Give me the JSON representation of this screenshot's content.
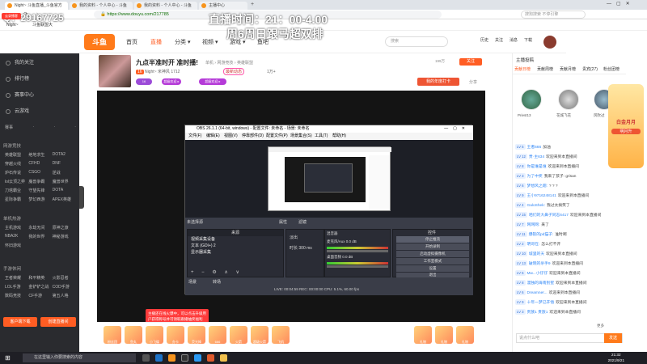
{
  "browser": {
    "tabs": [
      {
        "label": "Night~ 斗鱼直播_斗鱼官方"
      },
      {
        "label": "我的资料 - 个人中心 - 斗鱼"
      },
      {
        "label": "我的资料 - 个人中心 - 斗鱼"
      },
      {
        "label": "主播中心"
      }
    ],
    "url": "https://www.douyu.com/217785",
    "search_placeholder": "搜狗搜索 不停引擎",
    "bookmarks": [
      "Night~",
      "斗鱼联盟大"
    ]
  },
  "overlay": {
    "qq": "Q：29167725",
    "live_time": "直播时间：21：00-4.00",
    "schedule": "周6周日跟马超双排",
    "corner_badge": "云录播客"
  },
  "header": {
    "logo": "斗鱼",
    "nav": [
      "首页",
      "直播",
      "分类 ▾",
      "视频 ▾",
      "游戏 ▾",
      "鱼吧"
    ],
    "search_placeholder": "搜索",
    "user_icons": [
      "历史",
      "关注",
      "消息",
      "下载"
    ]
  },
  "sidebar": {
    "items": [
      "我的关注",
      "排行榜",
      "赛事中心",
      "云游戏"
    ],
    "icons_row": [
      "赛事",
      "·",
      "·",
      "·"
    ],
    "sections": [
      {
        "title": "网游竞技",
        "entries": [
          "英雄联盟",
          "绝地求生",
          "DOTA2",
          "穿越火线",
          "CFHD",
          "DNF",
          "炉石传说",
          "CSGO",
          "逆战",
          "lol云顶之弈",
          "魔兽争霸",
          "魔兽世界",
          "刀塔霸业",
          "守望先锋",
          "DOTA",
          "星际争霸",
          "梦幻西游",
          "APEX英雄"
        ]
      },
      {
        "title": "单机热游",
        "entries": [
          "主机游戏",
          "永劫无间",
          "原神之旅",
          "NBA2K",
          "我的世界",
          "神秘游戏",
          "怀旧游戏",
          "",
          ""
        ]
      },
      {
        "title": "手游休闲",
        "entries": [
          "王者荣耀",
          "和平精英",
          "火影忍者",
          "LOL手游",
          "金铲铲之战",
          "COD手游",
          "数码竞技",
          "CF手游",
          "第五人格"
        ]
      }
    ],
    "footer_buttons": [
      "客户端下载",
      "创建直播间"
    ]
  },
  "room": {
    "title": "九点半准时开 准时播!",
    "category": "单机",
    "tags": [
      "网游竞技",
      "英雄联盟"
    ],
    "anchor": "Night~ 米神风",
    "level": "16",
    "fans": "1712",
    "hot": "1万+",
    "badges": [
      "最新动态",
      "超级欢迎 ▸",
      "超级欢迎 ▸"
    ],
    "follow_button": "关注",
    "report_button": "举报",
    "follower_count": "199万",
    "share_label": "分享",
    "activity_badge": "我的年度打卡"
  },
  "obs": {
    "window_title": "OBS 26.1.1 (64-bit, windows) - 配置文件: 未命名 - 场景: 未命名",
    "menu": [
      "文件(F)",
      "编辑(E)",
      "视图(V)",
      "停靠部件(D)",
      "配置文件(P)",
      "场景集合(S)",
      "工具(T)",
      "帮助(H)"
    ],
    "status_text": "未选择源",
    "properties_label": "属性",
    "filters_label": "滤镜",
    "sources_header": "来源",
    "sources": [
      "视频采集设备",
      "文本 (GDI+) 2",
      "显示器采集"
    ],
    "audio_header": "混音器",
    "audio_channels": [
      {
        "name": "麦克风/Aux",
        "level": "0.0 dB"
      },
      {
        "name": "桌面音频",
        "level": "0.0 dB"
      }
    ],
    "transition": "淡出",
    "duration_label": "时长",
    "duration_value": "300 ms",
    "controls_header": "控件",
    "controls": [
      "停止推流",
      "开始录制",
      "启动虚拟摄像机",
      "工作室模式",
      "设置",
      "退出"
    ],
    "tabs": [
      "场景",
      "转场"
    ],
    "statusbar": "LIVE: 00:04:59  REC: 00:00:00  CPU: 5.1%, 60.00 fps"
  },
  "gift_tip": "主播还在线火爆中，可以点击升级用户获得称号并可领取跟播抽奖福利",
  "gifts": [
    "粉丝团",
    "鱼丸",
    "小飞碟",
    "办卡",
    "荧光棒",
    "666",
    "火箭",
    "超级火箭",
    "飞机",
    "礼物",
    "礼物",
    "礼物",
    "礼物",
    "礼物",
    "礼物"
  ],
  "chat": {
    "top_label": "主播投稿",
    "tabs": [
      "贡献日榜",
      "贡献周榜",
      "贡献月榜",
      "贵宾(27)",
      "粉丝团榜"
    ],
    "rank_names": [
      "Priest13",
      "花城飞花",
      "风吹过"
    ],
    "messages": [
      {
        "level": "LV 5",
        "nick": "王者666",
        "text": "加油"
      },
      {
        "level": "LV 12",
        "nick": "贵·主634",
        "text": "欢迎来到本直播间"
      },
      {
        "level": "LV 8",
        "nick": "你是谁是谁",
        "text": "欢迎来到本直播间"
      },
      {
        "level": "LV 3",
        "nick": "为了中奖",
        "text": "我来了孩子: grisan"
      },
      {
        "level": "LV 6",
        "nick": "梦想风之翔:",
        "text": "? ? ?"
      },
      {
        "level": "LV 9",
        "nick": "王小9716248141",
        "text": "欢迎来到本直播间"
      },
      {
        "level": "LV 4",
        "nick": "GaloShek:",
        "text": "我过太搞笑了"
      },
      {
        "level": "LV 15",
        "nick": "咱们的大鼻子同志6417",
        "text": "欢迎来到本直播间"
      },
      {
        "level": "LV 7",
        "nick": "网网网:",
        "text": "来了"
      },
      {
        "level": "LV 11",
        "nick": "爆裂的pd猫子:",
        "text": "准时啊"
      },
      {
        "level": "LV 2",
        "nick": "明哥在:",
        "text": "怎么打不开"
      },
      {
        "level": "LV 10",
        "nick": "城里的天",
        "text": "欢迎来到本直播间"
      },
      {
        "level": "LV 13",
        "nick": "破晓的杀手9",
        "text": "欢迎来到本直播间"
      },
      {
        "level": "LV 5",
        "nick": "Mw...小仔仔",
        "text": "欢迎来到本直播间"
      },
      {
        "level": "LV 8",
        "nick": "漫独的海南别墅",
        "text": "欢迎来到本直播间"
      },
      {
        "level": "LV 6",
        "nick": "Dreamner...",
        "text": "欢迎来到本直播间"
      },
      {
        "level": "LV 9",
        "nick": "十年一梦已开悟",
        "text": "欢迎来到本直播间"
      },
      {
        "level": "LV 3",
        "nick": "贵族1 贵族1",
        "text": "欢迎来到本直播间"
      }
    ],
    "input_placeholder": "说点什么吧",
    "send_button": "发送",
    "expand_label": "更多",
    "side_promo": "白金月月",
    "side_promo_sub": "明月升"
  },
  "taskbar": {
    "search_placeholder": "在这里输入你要搜索的内容",
    "time": "21:32",
    "date": "2021/9/21"
  }
}
